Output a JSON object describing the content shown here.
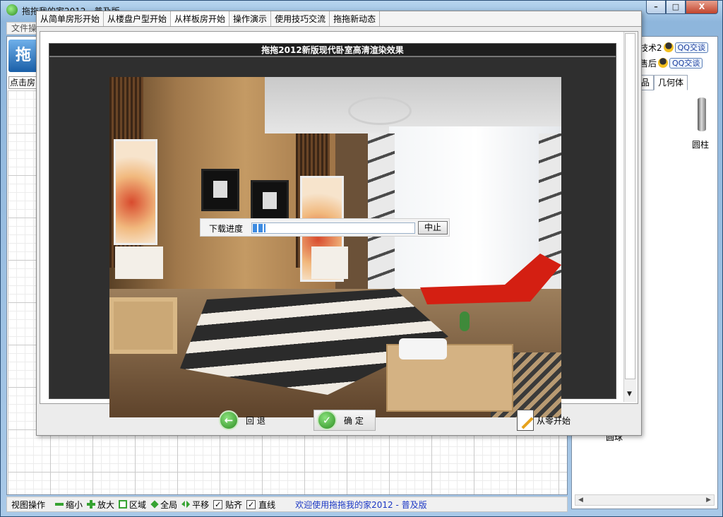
{
  "window": {
    "title": "拖拖我的家2012 - 普及版",
    "controls": {
      "minimize": "–",
      "maximize": "□",
      "close": "X"
    }
  },
  "menu": {
    "file": "文件操"
  },
  "left": {
    "logo_text": "拖",
    "hint_text": "点击房间"
  },
  "right_panel": {
    "qq_rows": [
      {
        "label": "技术2",
        "button": "QQ交谈"
      },
      {
        "label": "售后",
        "button": "QQ交谈"
      }
    ],
    "tabs": [
      "品",
      "几何体"
    ],
    "items": [
      "圆柱",
      "圆球"
    ]
  },
  "statusbar": {
    "view_ops": "视图操作",
    "zoom_out": "缩小",
    "zoom_in": "放大",
    "region": "区域",
    "global": "全局",
    "pan": "平移",
    "snap": "贴齐",
    "snap_checked": "✓",
    "straight": "直线",
    "straight_checked": "✓",
    "welcome": "欢迎使用拖拖我的家2012 - 普及版"
  },
  "dialog": {
    "tabs": [
      "从简单房形开始",
      "从楼盘户型开始",
      "从样板房开始",
      "操作演示",
      "使用技巧交流",
      "拖拖新动态"
    ],
    "active_tab_index": 2,
    "viewer_title": "拖拖2012新版现代卧室高清渲染效果",
    "progress": {
      "label": "下载进度",
      "value_percent": 8,
      "stop_label": "中止"
    },
    "buttons": {
      "back": "回 退",
      "ok": "确 定",
      "start_new": "从零开始"
    }
  },
  "colors": {
    "accent_blue": "#1b37c4",
    "green_icon": "#36a332",
    "chair_red": "#d41f12"
  }
}
